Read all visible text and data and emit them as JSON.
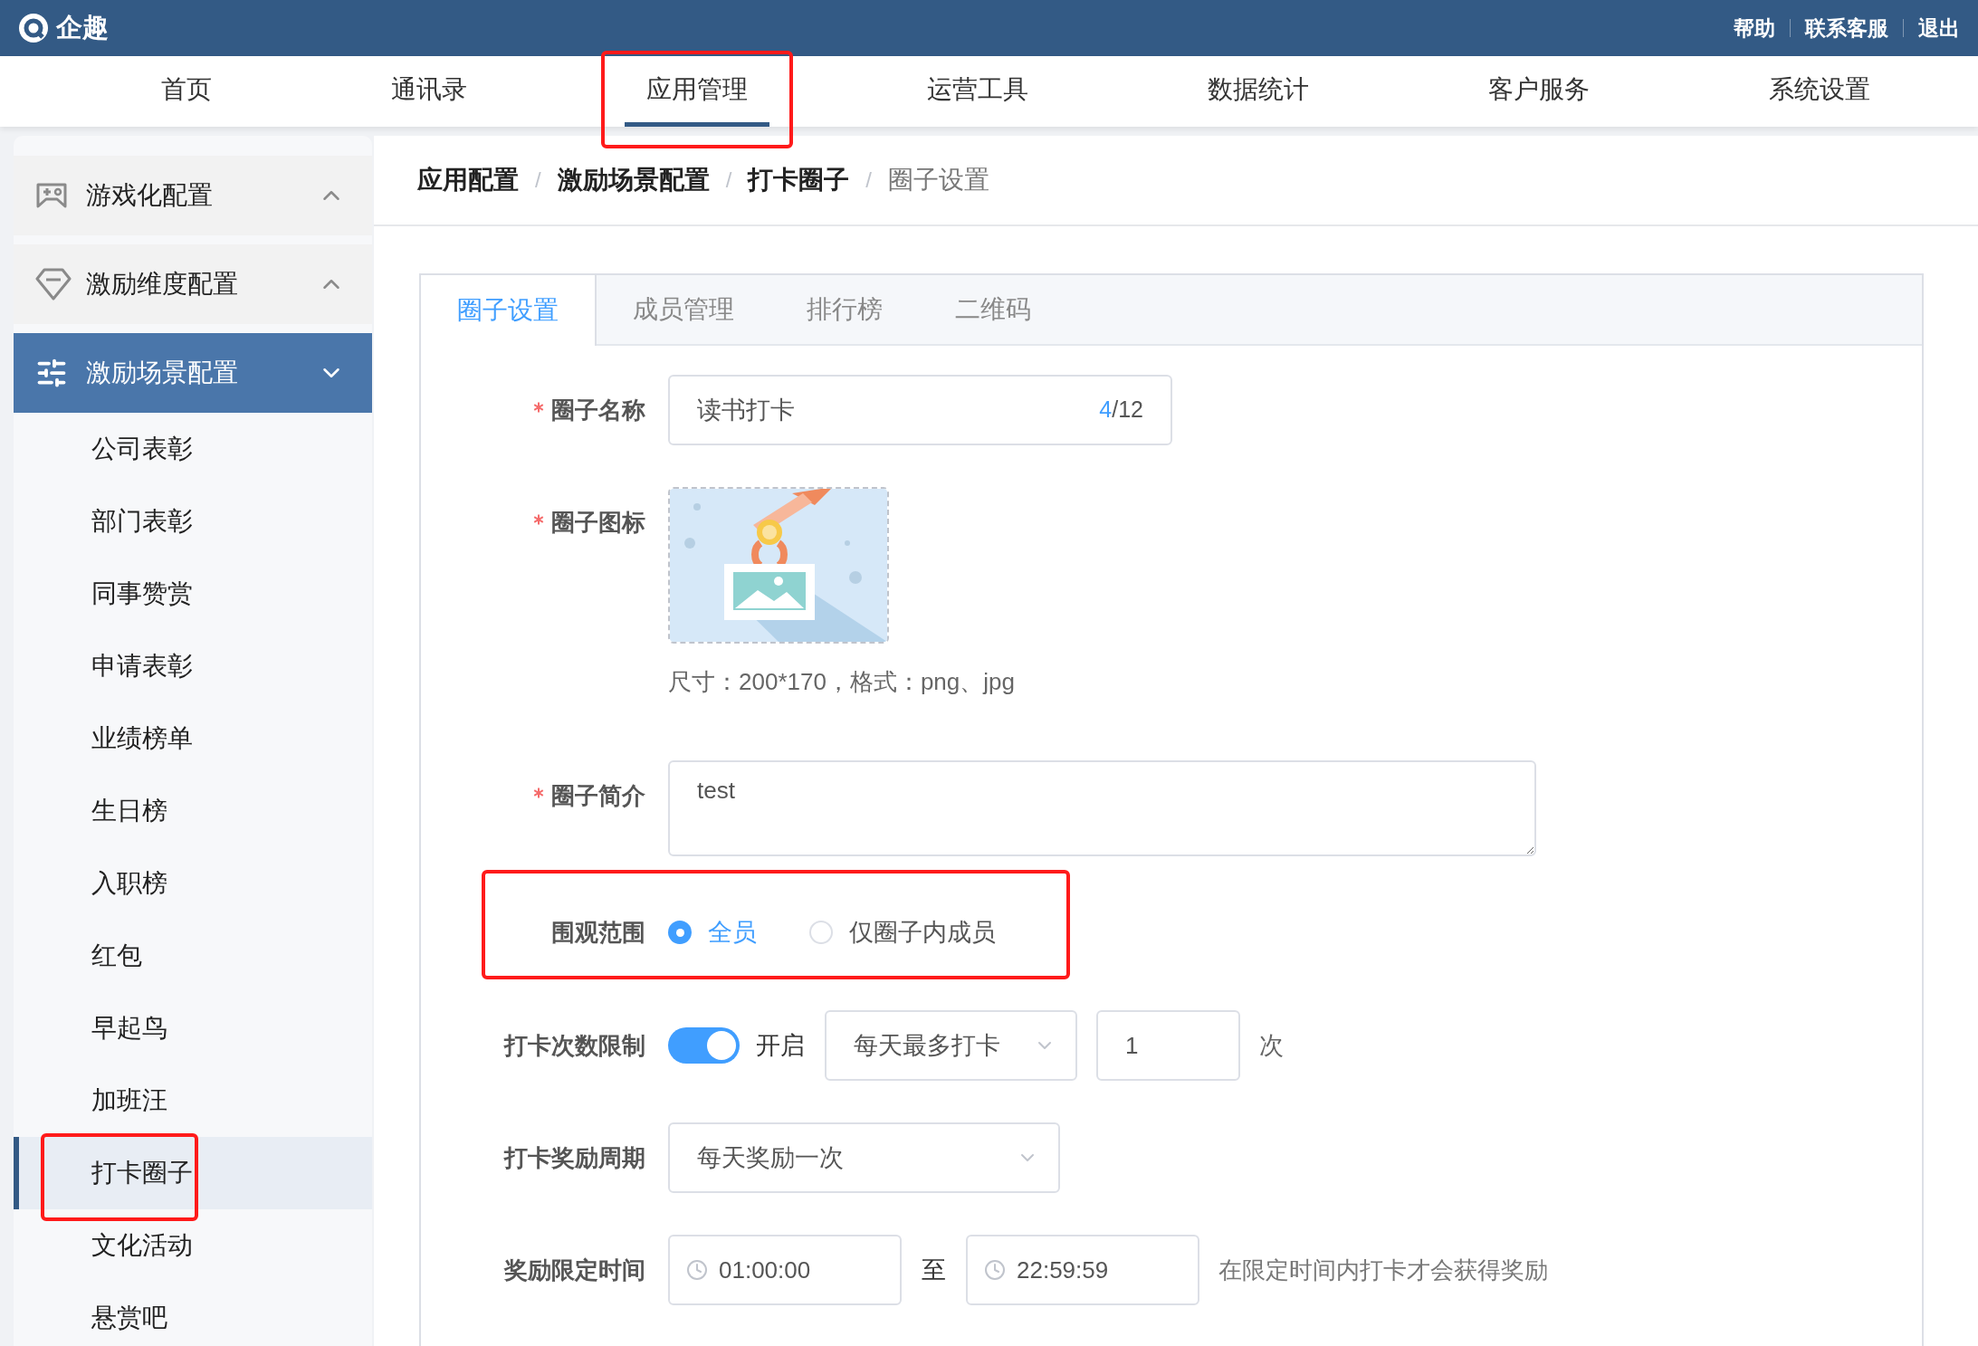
{
  "brand": {
    "name": "企趣"
  },
  "top_links": [
    "帮助",
    "联系客服",
    "退出"
  ],
  "nav": [
    {
      "label": "首页",
      "selected": false,
      "highlighted": false
    },
    {
      "label": "通讯录",
      "selected": false,
      "highlighted": false
    },
    {
      "label": "应用管理",
      "selected": true,
      "highlighted": true
    },
    {
      "label": "运营工具",
      "selected": false,
      "highlighted": false
    },
    {
      "label": "数据统计",
      "selected": false,
      "highlighted": false
    },
    {
      "label": "客户服务",
      "selected": false,
      "highlighted": false
    },
    {
      "label": "系统设置",
      "selected": false,
      "highlighted": false
    }
  ],
  "sidebar": {
    "groups": [
      {
        "label": "游戏化配置",
        "kind": "gamepad",
        "selected": false,
        "expanded": false
      },
      {
        "label": "激励维度配置",
        "kind": "gem",
        "selected": false,
        "expanded": false
      },
      {
        "label": "激励场景配置",
        "kind": "sliders",
        "selected": true,
        "expanded": true,
        "children": [
          {
            "label": "公司表彰",
            "selected": false,
            "highlighted": false
          },
          {
            "label": "部门表彰",
            "selected": false,
            "highlighted": false
          },
          {
            "label": "同事赞赏",
            "selected": false,
            "highlighted": false
          },
          {
            "label": "申请表彰",
            "selected": false,
            "highlighted": false
          },
          {
            "label": "业绩榜单",
            "selected": false,
            "highlighted": false
          },
          {
            "label": "生日榜",
            "selected": false,
            "highlighted": false
          },
          {
            "label": "入职榜",
            "selected": false,
            "highlighted": false
          },
          {
            "label": "红包",
            "selected": false,
            "highlighted": false
          },
          {
            "label": "早起鸟",
            "selected": false,
            "highlighted": false
          },
          {
            "label": "加班汪",
            "selected": false,
            "highlighted": false
          },
          {
            "label": "打卡圈子",
            "selected": true,
            "highlighted": true
          },
          {
            "label": "文化活动",
            "selected": false,
            "highlighted": false
          },
          {
            "label": "悬赏吧",
            "selected": false,
            "highlighted": false
          }
        ]
      }
    ]
  },
  "breadcrumb": {
    "separator": "/",
    "items": [
      "应用配置",
      "激励场景配置",
      "打卡圈子",
      "圈子设置"
    ]
  },
  "tabs": [
    {
      "label": "圈子设置",
      "selected": true
    },
    {
      "label": "成员管理",
      "selected": false
    },
    {
      "label": "排行榜",
      "selected": false
    },
    {
      "label": "二维码",
      "selected": false
    }
  ],
  "form": {
    "name": {
      "label": "圈子名称",
      "required": true,
      "value": "读书打卡",
      "count": "4",
      "limit": "/12"
    },
    "icon": {
      "label": "圈子图标",
      "required": true,
      "hint": "尺寸：200*170，格式：png、jpg"
    },
    "intro": {
      "label": "圈子简介",
      "required": true,
      "value": "test"
    },
    "scope": {
      "label": "围观范围",
      "highlighted": true,
      "options": [
        {
          "label": "全员",
          "selected": true
        },
        {
          "label": "仅圈子内成员",
          "selected": false
        }
      ]
    },
    "limit": {
      "label": "打卡次数限制",
      "on": true,
      "switch_label": "开启",
      "period": "每天最多打卡",
      "count": "1",
      "unit": "次"
    },
    "reward_period": {
      "label": "打卡奖励周期",
      "value": "每天奖励一次"
    },
    "reward_time": {
      "label": "奖励限定时间",
      "start": "01:00:00",
      "separator": "至",
      "end": "22:59:59",
      "note": "在限定时间内打卡才会获得奖励"
    }
  }
}
